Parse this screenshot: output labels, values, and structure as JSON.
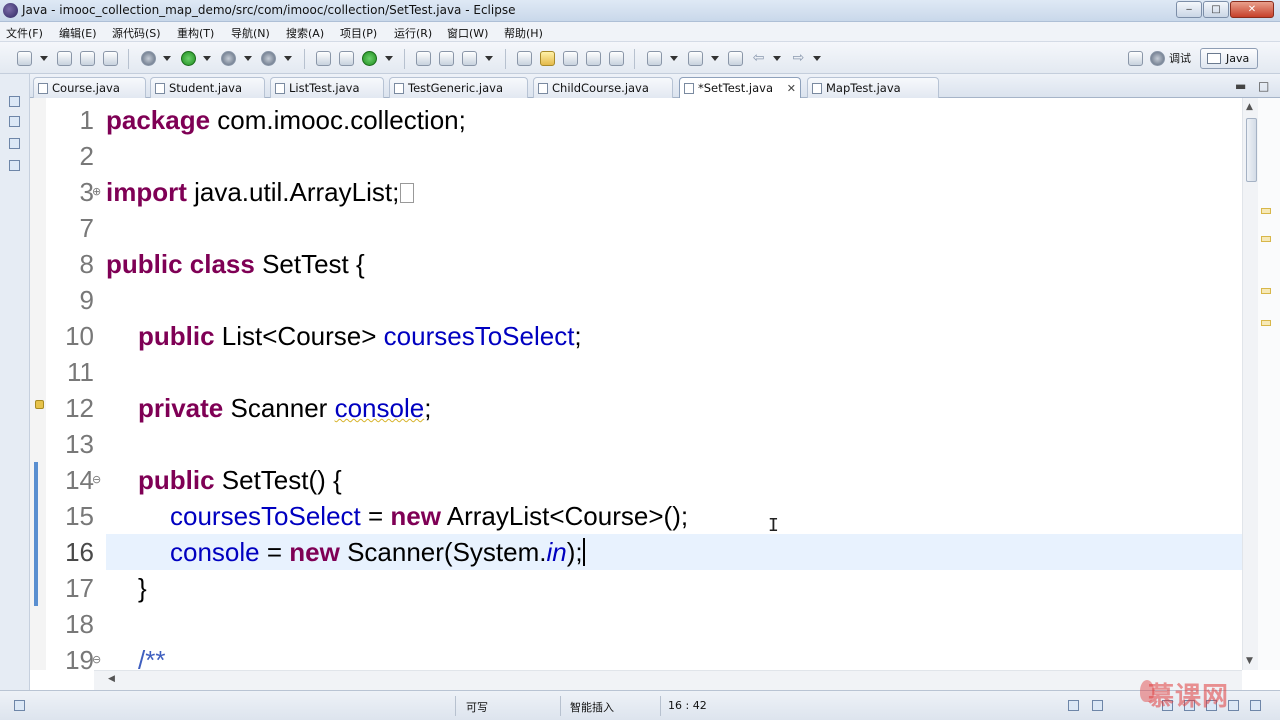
{
  "window": {
    "title": "Java - imooc_collection_map_demo/src/com/imooc/collection/SetTest.java - Eclipse",
    "minimize": "‒",
    "maximize": "□",
    "close": "✕"
  },
  "menu": {
    "file": "文件(F)",
    "edit": "编辑(E)",
    "source": "源代码(S)",
    "refactor": "重构(T)",
    "navigate": "导航(N)",
    "search": "搜索(A)",
    "project": "项目(P)",
    "run": "运行(R)",
    "window": "窗口(W)",
    "help": "帮助(H)"
  },
  "perspectives": {
    "debug": "调试",
    "java": "Java"
  },
  "tabs": [
    {
      "label": "Course.java"
    },
    {
      "label": "Student.java"
    },
    {
      "label": "ListTest.java"
    },
    {
      "label": "TestGeneric.java"
    },
    {
      "label": "ChildCourse.java"
    },
    {
      "label": "*SetTest.java",
      "active": true
    },
    {
      "label": "MapTest.java"
    }
  ],
  "editor": {
    "line_numbers": [
      "1",
      "2",
      "3",
      "7",
      "8",
      "9",
      "10",
      "11",
      "12",
      "13",
      "14",
      "15",
      "16",
      "17",
      "18",
      "19"
    ],
    "current_line": "16",
    "code": {
      "l1_kw": "package",
      "l1_rest": " com.imooc.collection;",
      "l3_kw": "import",
      "l3_rest": " java.util.ArrayList;",
      "l8_kw": "public class",
      "l8_rest": " SetTest {",
      "l10_kw": "public",
      "l10_type": " List<Course> ",
      "l10_field": "coursesToSelect",
      "l10_end": ";",
      "l12_kw": "private",
      "l12_type": " Scanner ",
      "l12_field": "console",
      "l12_end": ";",
      "l14_kw": "public",
      "l14_rest": " SetTest() {",
      "l15_field": "coursesToSelect",
      "l15_mid": " = ",
      "l15_kw": "new",
      "l15_rest": " ArrayList<Course>();",
      "l16_field": "console",
      "l16_mid": " = ",
      "l16_kw": "new",
      "l16_rest": " Scanner(System.",
      "l16_in": "in",
      "l16_end": ");",
      "l17": "}",
      "l19": "/**"
    }
  },
  "status": {
    "writable": "可写",
    "insert_mode": "智能插入",
    "position": "16 : 42"
  },
  "watermark": "慕课网"
}
